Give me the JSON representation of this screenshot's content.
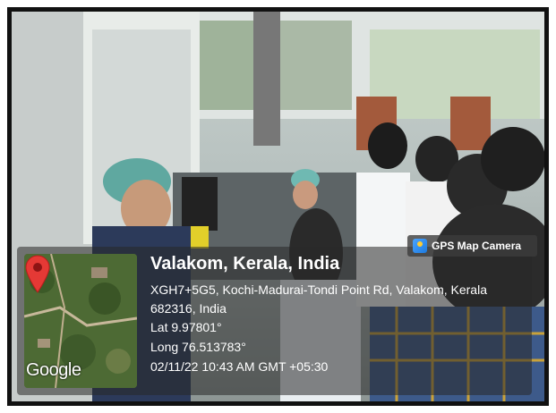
{
  "gps_badge": {
    "label": "GPS Map Camera",
    "icon": "camera-pin-icon"
  },
  "location": {
    "place": "Valakom, Kerala, India",
    "address": "XGH7+5G5, Kochi-Madurai-Tondi Point Rd, Valakom, Kerala 682316, India",
    "lat": "Lat 9.97801°",
    "long": "Long 76.513783°",
    "datetime": "02/11/22 10:43 AM GMT +05:30"
  },
  "map": {
    "brand": "Google",
    "pin_color": "#e53935"
  }
}
